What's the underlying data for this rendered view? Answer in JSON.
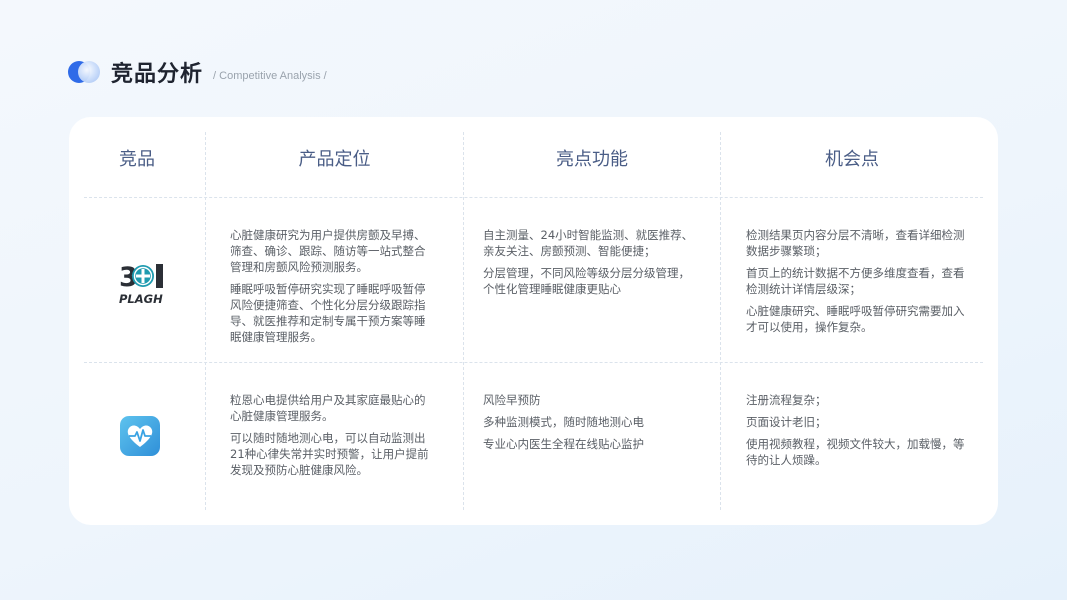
{
  "header": {
    "title": "竞品分析",
    "subtitle": "/ Competitive Analysis /"
  },
  "table": {
    "columns": [
      "竞品",
      "产品定位",
      "亮点功能",
      "机会点"
    ],
    "rows": [
      {
        "logo_icon": "plagh-logo-icon",
        "logo_text": "301 PLAGH",
        "positioning": [
          "心脏健康研究为用户提供房颤及早搏、筛查、确诊、跟踪、随访等一站式整合管理和房颤风险预测服务。",
          "睡眠呼吸暂停研究实现了睡眠呼吸暂停风险便捷筛查、个性化分层分级跟踪指导、就医推荐和定制专属干预方案等睡眠健康管理服务。"
        ],
        "highlights": [
          "自主测量、24小时智能监测、就医推荐、亲友关注、房颤预测、智能便捷；",
          "分层管理，不同风险等级分层分级管理，个性化管理睡眠健康更贴心"
        ],
        "opportunities": [
          "检测结果页内容分层不清晰，查看详细检测数据步骤繁琐；",
          "首页上的统计数据不方便多维度查看，查看检测统计详情层级深；",
          "心脏健康研究、睡眠呼吸暂停研究需要加入才可以使用，操作复杂。"
        ]
      },
      {
        "logo_icon": "heart-pulse-app-icon",
        "positioning": [
          "粒恩心电提供给用户及其家庭最贴心的心脏健康管理服务。",
          "可以随时随地测心电，可以自动监测出21种心律失常并实时预警，让用户提前发现及预防心脏健康风险。"
        ],
        "highlights": [
          "风险早预防",
          "多种监测模式，随时随地测心电",
          "专业心内医生全程在线贴心监护"
        ],
        "opportunities": [
          "注册流程复杂；",
          "页面设计老旧；",
          "使用视频教程，视频文件较大，加载慢，等待的让人烦躁。"
        ]
      }
    ]
  },
  "colors": {
    "accent": "#2f6be8",
    "header_text": "#4a5d86",
    "app_icon": "#3aa3e3"
  }
}
